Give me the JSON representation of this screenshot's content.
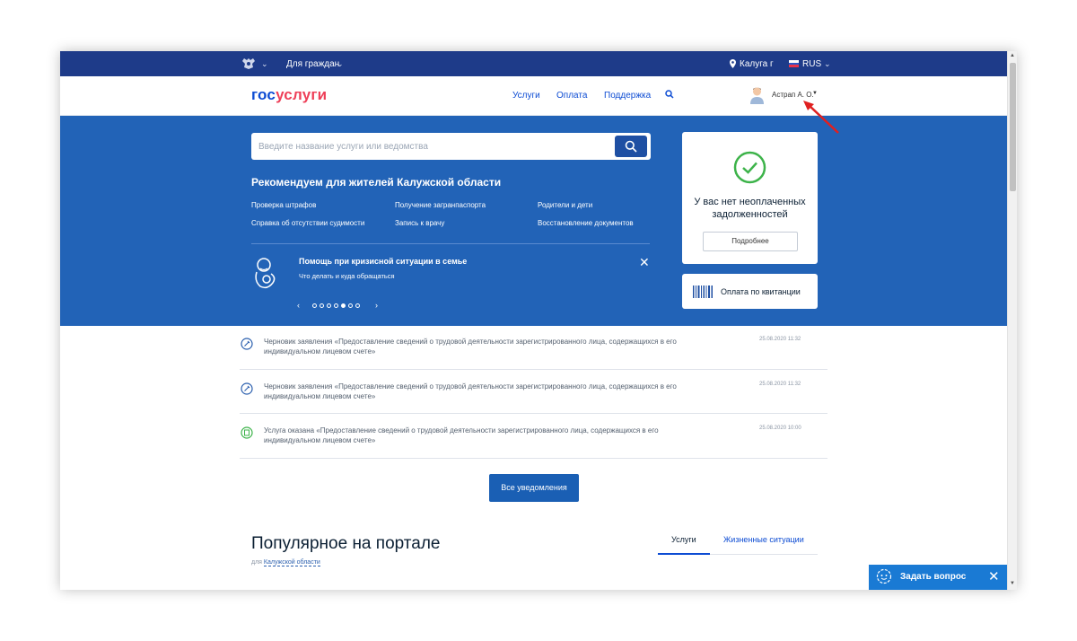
{
  "topbar": {
    "for_citizens": "Для граждан",
    "location": "Калуга г",
    "language": "RUS"
  },
  "header": {
    "logo_part1": "гос",
    "logo_part2": "услуги",
    "nav": [
      "Услуги",
      "Оплата",
      "Поддержка"
    ],
    "user_name": "Астрап А. О."
  },
  "hero": {
    "search_placeholder": "Введите название услуги или ведомства",
    "recommend_title": "Рекомендуем для жителей Калужской области",
    "links": [
      "Проверка штрафов",
      "Получение загранпаспорта",
      "Родители и дети",
      "Справка об отсутствии судимости",
      "Запись к врачу",
      "Восстановление документов"
    ],
    "promo_title": "Помощь при кризисной ситуации в семье",
    "promo_subtitle": "Что делать и куда обращаться",
    "carousel_active_index": 4
  },
  "debt_card": {
    "text": "У вас нет неоплаченных задолженностей",
    "button": "Подробнее"
  },
  "pay_card": {
    "label": "Оплата по квитанции"
  },
  "notifications": [
    {
      "text": "Черновик заявления «Предоставление сведений о трудовой деятельности зарегистрированного лица, содержащихся в его индивидуальном лицевом счете»",
      "date": "25.08.2020 11:32",
      "status": "draft"
    },
    {
      "text": "Черновик заявления «Предоставление сведений о трудовой деятельности зарегистрированного лица, содержащихся в его индивидуальном лицевом счете»",
      "date": "25.08.2020 11:32",
      "status": "draft"
    },
    {
      "text": "Услуга оказана «Предоставление сведений о трудовой деятельности зарегистрированного лица, содержащихся в его индивидуальном лицевом счете»",
      "date": "25.08.2020 10:00",
      "status": "done"
    }
  ],
  "all_notifications_button": "Все уведомления",
  "popular": {
    "title": "Популярное на портале",
    "for_prefix": "для",
    "region_link": "Калужской области",
    "tabs": [
      "Услуги",
      "Жизненные ситуации"
    ]
  },
  "chat": {
    "label": "Задать вопрос"
  },
  "colors": {
    "topbar": "#1e3b89",
    "hero": "#2263b7",
    "accent": "#0d4cd3",
    "logo_red": "#ee3f58",
    "success": "#3db34a",
    "chat": "#1a7ad4"
  }
}
